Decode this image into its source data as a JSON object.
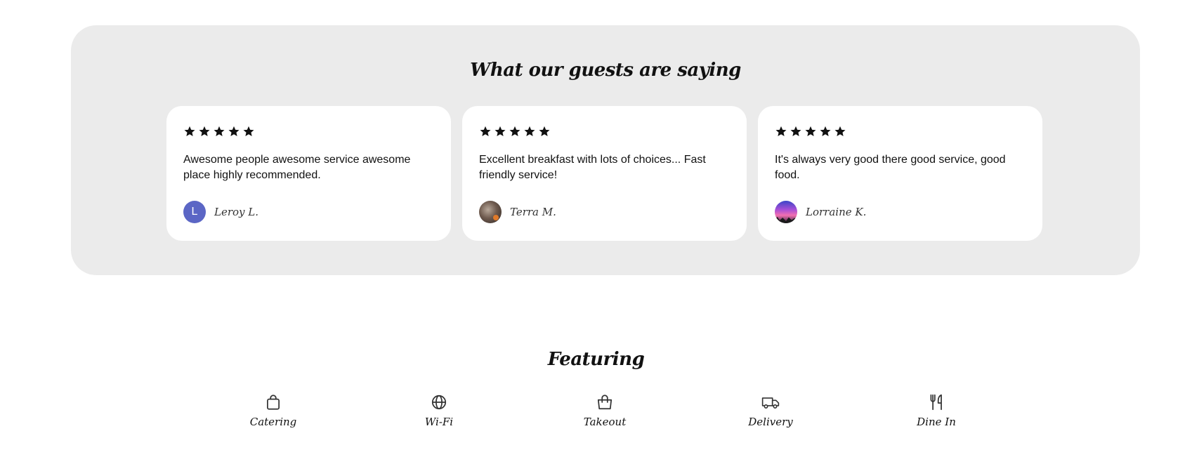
{
  "testimonials": {
    "title": "What our guests are saying",
    "reviews": [
      {
        "rating": 5,
        "text": "Awesome people awesome service awesome place highly recommended.",
        "author": "Leroy L.",
        "avatar_letter": "L"
      },
      {
        "rating": 5,
        "text": "Excellent breakfast with lots of choices... Fast friendly service!",
        "author": "Terra M."
      },
      {
        "rating": 5,
        "text": "It's always very good there good service, good food.",
        "author": "Lorraine K."
      }
    ]
  },
  "featuring": {
    "title": "Featuring",
    "items": [
      {
        "label": "Catering",
        "icon": "bag-icon"
      },
      {
        "label": "Wi-Fi",
        "icon": "globe-icon"
      },
      {
        "label": "Takeout",
        "icon": "shopping-bag-icon"
      },
      {
        "label": "Delivery",
        "icon": "truck-icon"
      },
      {
        "label": "Dine In",
        "icon": "fork-knife-icon"
      }
    ]
  },
  "colors": {
    "section_background": "#ebebeb",
    "card_background": "#ffffff",
    "avatar_letter_background": "#5b66c5",
    "text": "#111111"
  }
}
